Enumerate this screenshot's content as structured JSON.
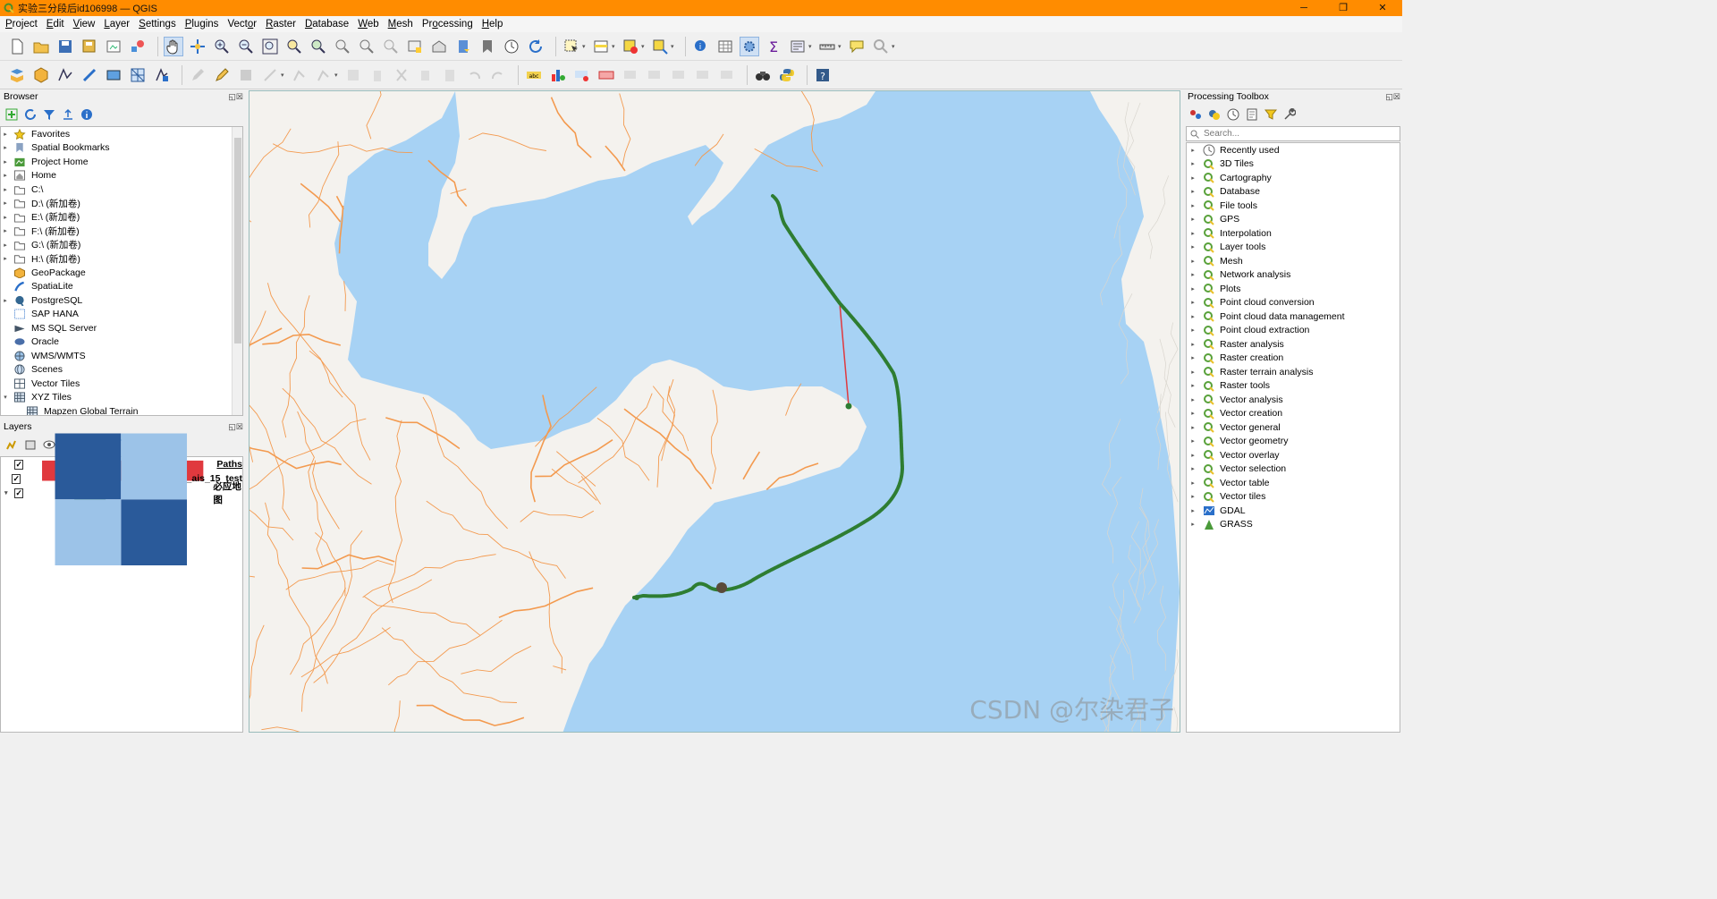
{
  "window": {
    "title": "实验三分段后id106998 — QGIS",
    "min": "─",
    "max": "❐",
    "close": "✕"
  },
  "menu": [
    {
      "label": "Project",
      "u": "P"
    },
    {
      "label": "Edit",
      "u": "E"
    },
    {
      "label": "View",
      "u": "V"
    },
    {
      "label": "Layer",
      "u": "L"
    },
    {
      "label": "Settings",
      "u": "S"
    },
    {
      "label": "Plugins",
      "u": "P"
    },
    {
      "label": "Vector",
      "u": "o"
    },
    {
      "label": "Raster",
      "u": "R"
    },
    {
      "label": "Database",
      "u": "D"
    },
    {
      "label": "Web",
      "u": "W"
    },
    {
      "label": "Mesh",
      "u": "M"
    },
    {
      "label": "Processing",
      "u": "o"
    },
    {
      "label": "Help",
      "u": "H"
    }
  ],
  "browser": {
    "title": "Browser",
    "items": [
      {
        "label": "Favorites",
        "icon": "star-icon",
        "arrow": "▸"
      },
      {
        "label": "Spatial Bookmarks",
        "icon": "bookmark-icon",
        "arrow": "▸"
      },
      {
        "label": "Project Home",
        "icon": "project-home-icon",
        "arrow": "▸"
      },
      {
        "label": "Home",
        "icon": "home-icon",
        "arrow": "▸"
      },
      {
        "label": "C:\\",
        "icon": "folder-icon",
        "arrow": "▸"
      },
      {
        "label": "D:\\ (新加卷)",
        "icon": "folder-icon",
        "arrow": "▸"
      },
      {
        "label": "E:\\ (新加卷)",
        "icon": "folder-icon",
        "arrow": "▸"
      },
      {
        "label": "F:\\ (新加卷)",
        "icon": "folder-icon",
        "arrow": "▸"
      },
      {
        "label": "G:\\ (新加卷)",
        "icon": "folder-icon",
        "arrow": "▸"
      },
      {
        "label": "H:\\ (新加卷)",
        "icon": "folder-icon",
        "arrow": "▸"
      },
      {
        "label": "GeoPackage",
        "icon": "geopackage-icon",
        "arrow": ""
      },
      {
        "label": "SpatiaLite",
        "icon": "spatialite-icon",
        "arrow": ""
      },
      {
        "label": "PostgreSQL",
        "icon": "postgresql-icon",
        "arrow": "▸"
      },
      {
        "label": "SAP HANA",
        "icon": "sap-hana-icon",
        "arrow": ""
      },
      {
        "label": "MS SQL Server",
        "icon": "mssql-icon",
        "arrow": ""
      },
      {
        "label": "Oracle",
        "icon": "oracle-icon",
        "arrow": ""
      },
      {
        "label": "WMS/WMTS",
        "icon": "wms-icon",
        "arrow": ""
      },
      {
        "label": "Scenes",
        "icon": "scenes-icon",
        "arrow": ""
      },
      {
        "label": "Vector Tiles",
        "icon": "vector-tiles-icon",
        "arrow": ""
      },
      {
        "label": "XYZ Tiles",
        "icon": "xyz-tiles-icon",
        "arrow": "▾"
      },
      {
        "label": "Mapzen Global Terrain",
        "icon": "xyz-tiles-icon",
        "arrow": "",
        "indent": true
      }
    ]
  },
  "layers": {
    "title": "Layers",
    "items": [
      {
        "label": "Paths",
        "icon": "line-symbol-icon",
        "checked": "✓",
        "underline": true
      },
      {
        "label": "sample_ais_15_test",
        "icon": "point-symbol-icon",
        "checked": "✓"
      },
      {
        "label": "必应地图",
        "icon": "raster-icon",
        "checked": "✓",
        "expand": "▾"
      }
    ]
  },
  "processing": {
    "title": "Processing Toolbox",
    "search_placeholder": "Search...",
    "items": [
      {
        "label": "Recently used",
        "icon": "clock-icon"
      },
      {
        "label": "3D Tiles",
        "icon": "qgis-q-icon"
      },
      {
        "label": "Cartography",
        "icon": "qgis-q-icon"
      },
      {
        "label": "Database",
        "icon": "qgis-q-icon"
      },
      {
        "label": "File tools",
        "icon": "qgis-q-icon"
      },
      {
        "label": "GPS",
        "icon": "qgis-q-icon"
      },
      {
        "label": "Interpolation",
        "icon": "qgis-q-icon"
      },
      {
        "label": "Layer tools",
        "icon": "qgis-q-icon"
      },
      {
        "label": "Mesh",
        "icon": "qgis-q-icon"
      },
      {
        "label": "Network analysis",
        "icon": "qgis-q-icon"
      },
      {
        "label": "Plots",
        "icon": "qgis-q-icon"
      },
      {
        "label": "Point cloud conversion",
        "icon": "qgis-q-icon"
      },
      {
        "label": "Point cloud data management",
        "icon": "qgis-q-icon"
      },
      {
        "label": "Point cloud extraction",
        "icon": "qgis-q-icon"
      },
      {
        "label": "Raster analysis",
        "icon": "qgis-q-icon"
      },
      {
        "label": "Raster creation",
        "icon": "qgis-q-icon"
      },
      {
        "label": "Raster terrain analysis",
        "icon": "qgis-q-icon"
      },
      {
        "label": "Raster tools",
        "icon": "qgis-q-icon"
      },
      {
        "label": "Vector analysis",
        "icon": "qgis-q-icon"
      },
      {
        "label": "Vector creation",
        "icon": "qgis-q-icon"
      },
      {
        "label": "Vector general",
        "icon": "qgis-q-icon"
      },
      {
        "label": "Vector geometry",
        "icon": "qgis-q-icon"
      },
      {
        "label": "Vector overlay",
        "icon": "qgis-q-icon"
      },
      {
        "label": "Vector selection",
        "icon": "qgis-q-icon"
      },
      {
        "label": "Vector table",
        "icon": "qgis-q-icon"
      },
      {
        "label": "Vector tiles",
        "icon": "qgis-q-icon"
      },
      {
        "label": "GDAL",
        "icon": "gdal-icon"
      },
      {
        "label": "GRASS",
        "icon": "grass-icon"
      }
    ]
  },
  "colors": {
    "titlebar": "#ff8c00",
    "sea": "#a7d2f4",
    "land": "#f4f2ee",
    "roads": "#f39a4f",
    "track": "#2e7d32",
    "path_line": "#e0393e"
  },
  "watermark": "CSDN @尔染君子"
}
